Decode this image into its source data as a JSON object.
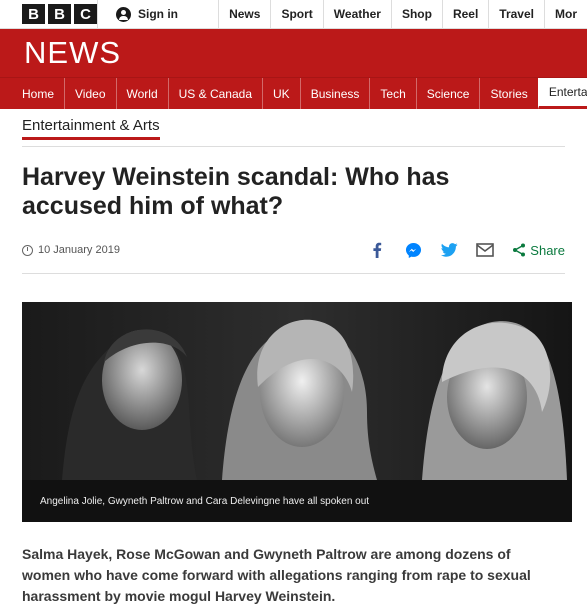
{
  "brand": {
    "letters": [
      "B",
      "B",
      "C"
    ]
  },
  "account": {
    "sign_in": "Sign in"
  },
  "top_nav": [
    "News",
    "Sport",
    "Weather",
    "Shop",
    "Reel",
    "Travel",
    "Mor"
  ],
  "news_wordmark": "NEWS",
  "main_nav": [
    "Home",
    "Video",
    "World",
    "US & Canada",
    "UK",
    "Business",
    "Tech",
    "Science",
    "Stories",
    "Entertai"
  ],
  "main_nav_active": "Entertai",
  "section": "Entertainment & Arts",
  "article": {
    "headline": "Harvey Weinstein scandal: Who has accused him of what?",
    "date": "10 January 2019",
    "share_label": "Share",
    "image_caption": "Angelina Jolie, Gwyneth Paltrow and Cara Delevingne have all spoken out",
    "summary": "Salma Hayek, Rose McGowan and Gwyneth Paltrow are among dozens of women who have come forward with allegations ranging from rape to sexual harassment by movie mogul Harvey Weinstein."
  },
  "colors": {
    "brand_red": "#bb1919",
    "share_green": "#0b7a3f",
    "facebook": "#3b5998",
    "messenger": "#0084ff",
    "twitter": "#1da1f2"
  },
  "icons": [
    "user-icon",
    "clock-icon",
    "facebook-icon",
    "messenger-icon",
    "twitter-icon",
    "email-icon",
    "share-icon"
  ]
}
